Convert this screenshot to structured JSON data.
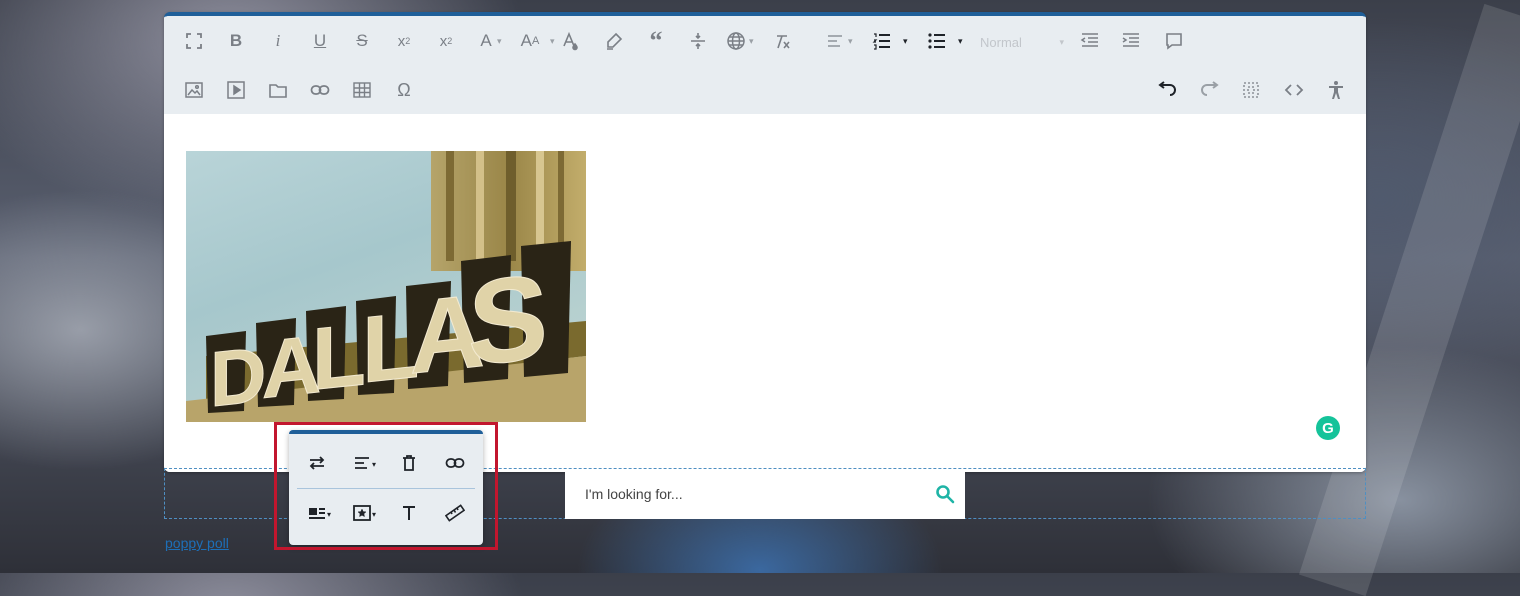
{
  "toolbar": {
    "row1": [
      {
        "name": "fullscreen-icon"
      },
      {
        "name": "bold-icon"
      },
      {
        "name": "italic-icon"
      },
      {
        "name": "underline-icon"
      },
      {
        "name": "strikethrough-icon"
      },
      {
        "name": "subscript-icon"
      },
      {
        "name": "superscript-icon"
      },
      {
        "name": "font-family-icon"
      },
      {
        "name": "font-size-icon"
      },
      {
        "name": "text-color-icon"
      },
      {
        "name": "highlight-icon"
      },
      {
        "name": "quote-icon"
      },
      {
        "name": "horizontal-line-icon"
      },
      {
        "name": "language-icon"
      },
      {
        "name": "clear-formatting-icon"
      },
      {
        "name": "align-icon"
      },
      {
        "name": "ordered-list-icon"
      },
      {
        "name": "unordered-list-icon"
      },
      {
        "name": "outdent-icon"
      },
      {
        "name": "indent-icon"
      },
      {
        "name": "comment-icon"
      }
    ],
    "paragraph_format": "Normal",
    "row2": [
      {
        "name": "insert-image-icon"
      },
      {
        "name": "insert-video-icon"
      },
      {
        "name": "insert-file-icon"
      },
      {
        "name": "insert-link-icon"
      },
      {
        "name": "insert-table-icon"
      },
      {
        "name": "special-characters-icon"
      },
      {
        "name": "undo-icon"
      },
      {
        "name": "redo-icon"
      },
      {
        "name": "select-all-icon"
      },
      {
        "name": "code-view-icon"
      },
      {
        "name": "accessibility-icon"
      }
    ]
  },
  "editor": {
    "image_sign_text": "DALLAS",
    "grammarly_badge": "G"
  },
  "image_popup": {
    "row1": [
      "replace-image-icon",
      "image-align-icon",
      "remove-image-icon",
      "image-link-icon"
    ],
    "row2": [
      "image-display-icon",
      "image-style-icon",
      "alt-text-icon",
      "image-size-icon"
    ]
  },
  "search": {
    "placeholder": "I'm looking for..."
  },
  "poll_link": "poppy poll",
  "colors": {
    "accent": "#1f5f99",
    "highlight": "#c2162e",
    "search_icon": "#1fb4a6",
    "grammarly": "#15c39a"
  }
}
